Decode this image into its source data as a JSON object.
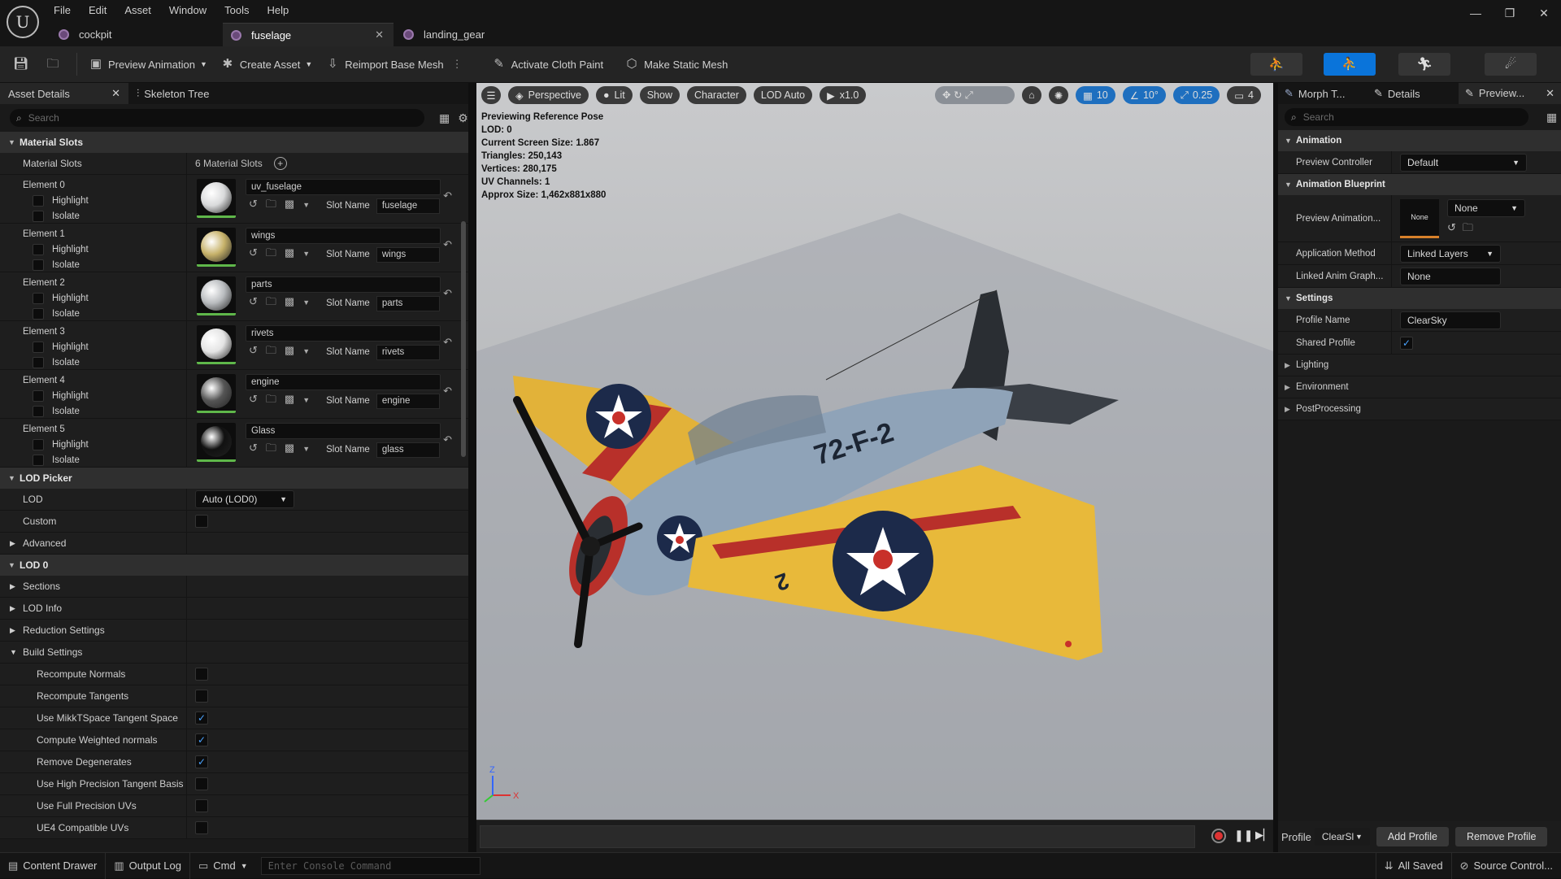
{
  "menu": [
    "File",
    "Edit",
    "Asset",
    "Window",
    "Tools",
    "Help"
  ],
  "tabs": [
    {
      "label": "cockpit"
    },
    {
      "label": "fuselage"
    },
    {
      "label": "landing_gear"
    }
  ],
  "toolbar": {
    "preview_animation": "Preview Animation",
    "create_asset": "Create Asset",
    "reimport": "Reimport Base Mesh",
    "cloth_paint": "Activate Cloth Paint",
    "static_mesh": "Make Static Mesh"
  },
  "left": {
    "tab_details": "Asset Details",
    "tab_skeleton": "Skeleton Tree",
    "search_placeholder": "Search",
    "material_slots_cat": "Material Slots",
    "material_slots_label": "Material Slots",
    "material_slots_count": "6 Material Slots",
    "highlight": "Highlight",
    "isolate": "Isolate",
    "slot_name_label": "Slot Name",
    "elements": [
      {
        "label": "Element 0",
        "material": "uv_fuselage",
        "slot": "fuselage"
      },
      {
        "label": "Element 1",
        "material": "wings",
        "slot": "wings"
      },
      {
        "label": "Element 2",
        "material": "parts",
        "slot": "parts"
      },
      {
        "label": "Element 3",
        "material": "rivets",
        "slot": "rivets"
      },
      {
        "label": "Element 4",
        "material": "engine",
        "slot": "engine"
      },
      {
        "label": "Element 5",
        "material": "Glass",
        "slot": "glass"
      }
    ],
    "lod_picker_cat": "LOD Picker",
    "lod_label": "LOD",
    "lod_value": "Auto (LOD0)",
    "custom": "Custom",
    "advanced": "Advanced",
    "lod0_cat": "LOD 0",
    "sections": "Sections",
    "lod_info": "LOD Info",
    "reduction": "Reduction Settings",
    "build_settings": "Build Settings",
    "build": [
      {
        "label": "Recompute Normals",
        "checked": false
      },
      {
        "label": "Recompute Tangents",
        "checked": false
      },
      {
        "label": "Use MikkTSpace Tangent Space",
        "checked": true
      },
      {
        "label": "Compute Weighted normals",
        "checked": true
      },
      {
        "label": "Remove Degenerates",
        "checked": true
      },
      {
        "label": "Use High Precision Tangent Basis",
        "checked": false
      },
      {
        "label": "Use Full Precision UVs",
        "checked": false
      },
      {
        "label": "UE4 Compatible UVs",
        "checked": false
      }
    ]
  },
  "viewport": {
    "perspective": "Perspective",
    "lit": "Lit",
    "show": "Show",
    "character": "Character",
    "lod_auto": "LOD Auto",
    "speed": "x1.0",
    "grid": "10",
    "angle": "10°",
    "scale": "0.25",
    "cam": "4",
    "info": [
      "Previewing Reference Pose",
      "LOD: 0",
      "Current Screen Size: 1.867",
      "Triangles: 250,143",
      "Vertices: 280,175",
      "UV Channels: 1",
      "Approx Size: 1,462x881x880"
    ],
    "plane_number": "72-F-2",
    "wing_number": "2",
    "axis_x": "X",
    "axis_z": "Z"
  },
  "right": {
    "tab_morph": "Morph T...",
    "tab_details": "Details",
    "tab_preview": "Preview...",
    "search_placeholder": "Search",
    "animation_cat": "Animation",
    "preview_controller_label": "Preview Controller",
    "preview_controller_value": "Default",
    "anim_bp_cat": "Animation Blueprint",
    "preview_anim_label": "Preview Animation...",
    "preview_anim_thumb": "None",
    "preview_anim_value": "None",
    "app_method_label": "Application Method",
    "app_method_value": "Linked Layers",
    "linked_graph_label": "Linked Anim Graph...",
    "linked_graph_value": "None",
    "settings_cat": "Settings",
    "profile_name_label": "Profile Name",
    "profile_name_value": "ClearSky",
    "shared_profile_label": "Shared Profile",
    "shared_profile_checked": true,
    "lighting": "Lighting",
    "environment": "Environment",
    "postprocessing": "PostProcessing",
    "profile_label": "Profile",
    "profile_combo": "ClearSl",
    "add_profile": "Add Profile",
    "remove_profile": "Remove Profile"
  },
  "status": {
    "content_drawer": "Content Drawer",
    "output_log": "Output Log",
    "cmd": "Cmd",
    "console_placeholder": "Enter Console Command",
    "all_saved": "All Saved",
    "source_control": "Source Control..."
  },
  "colors": {
    "accent": "#0a74da",
    "check": "#4aa3ff",
    "wing_yellow": "#e8b93a",
    "fuselage_blue": "#8fa3b8",
    "stripe_red": "#b8302a"
  }
}
